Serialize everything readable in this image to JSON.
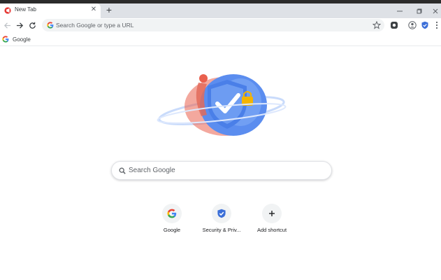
{
  "tab": {
    "title": "New Tab",
    "favicon": "opera-red-icon"
  },
  "window": {
    "controls": [
      "minimize-icon",
      "maximize-icon",
      "close-icon"
    ]
  },
  "toolbar": {
    "omnibox_placeholder": "Search Google or type a URL",
    "extensions": [
      "extension-icon",
      "profile-icon",
      "shield-extension-icon",
      "menu-icon"
    ]
  },
  "bookmarks": [
    {
      "label": "Google",
      "icon": "google-g-icon"
    }
  ],
  "ntp": {
    "search_placeholder": "Search Google",
    "shortcuts": [
      {
        "label": "Google",
        "icon": "google-g-icon"
      },
      {
        "label": "Security & Priv...",
        "icon": "shield-check-icon"
      },
      {
        "label": "Add shortcut",
        "icon": "plus-icon"
      }
    ]
  },
  "colors": {
    "tabstrip": "#dee1e6",
    "omnibox": "#f1f3f4",
    "accent_blue": "#4285f4",
    "shield_blue": "#3c6fd8"
  }
}
